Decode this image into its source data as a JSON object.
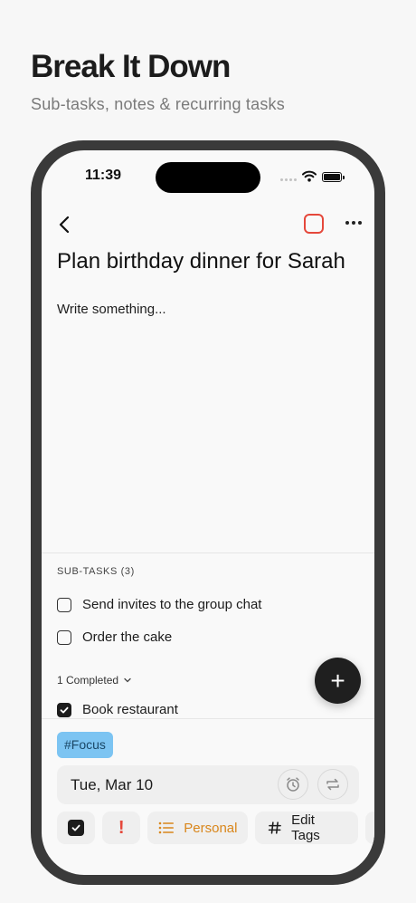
{
  "promo": {
    "title": "Break It Down",
    "subtitle": "Sub-tasks, notes & recurring tasks"
  },
  "status_bar": {
    "time": "11:39"
  },
  "task": {
    "title": "Plan birthday dinner for Sarah",
    "note_placeholder": "Write something...",
    "status_color": "#e5483b"
  },
  "subtasks": {
    "header": "SUB-TASKS (3)",
    "open": [
      {
        "label": "Send invites to the group chat",
        "checked": false
      },
      {
        "label": "Order the cake",
        "checked": false
      }
    ],
    "completed_toggle": "1 Completed",
    "completed": [
      {
        "label": "Book restaurant",
        "checked": true
      }
    ]
  },
  "fab": {
    "label": "+",
    "icon": "plus-icon"
  },
  "tag": {
    "label": "#Focus",
    "color": "#7cc4f2"
  },
  "due": {
    "date": "Tue, Mar 10",
    "reminder_icon": "alarm-icon",
    "repeat_icon": "repeat-icon"
  },
  "toolbar": {
    "priority_label": "!",
    "priority_color": "#e5483b",
    "list_label": "Personal",
    "list_color": "#d9861b",
    "tags_label": "Edit Tags"
  }
}
